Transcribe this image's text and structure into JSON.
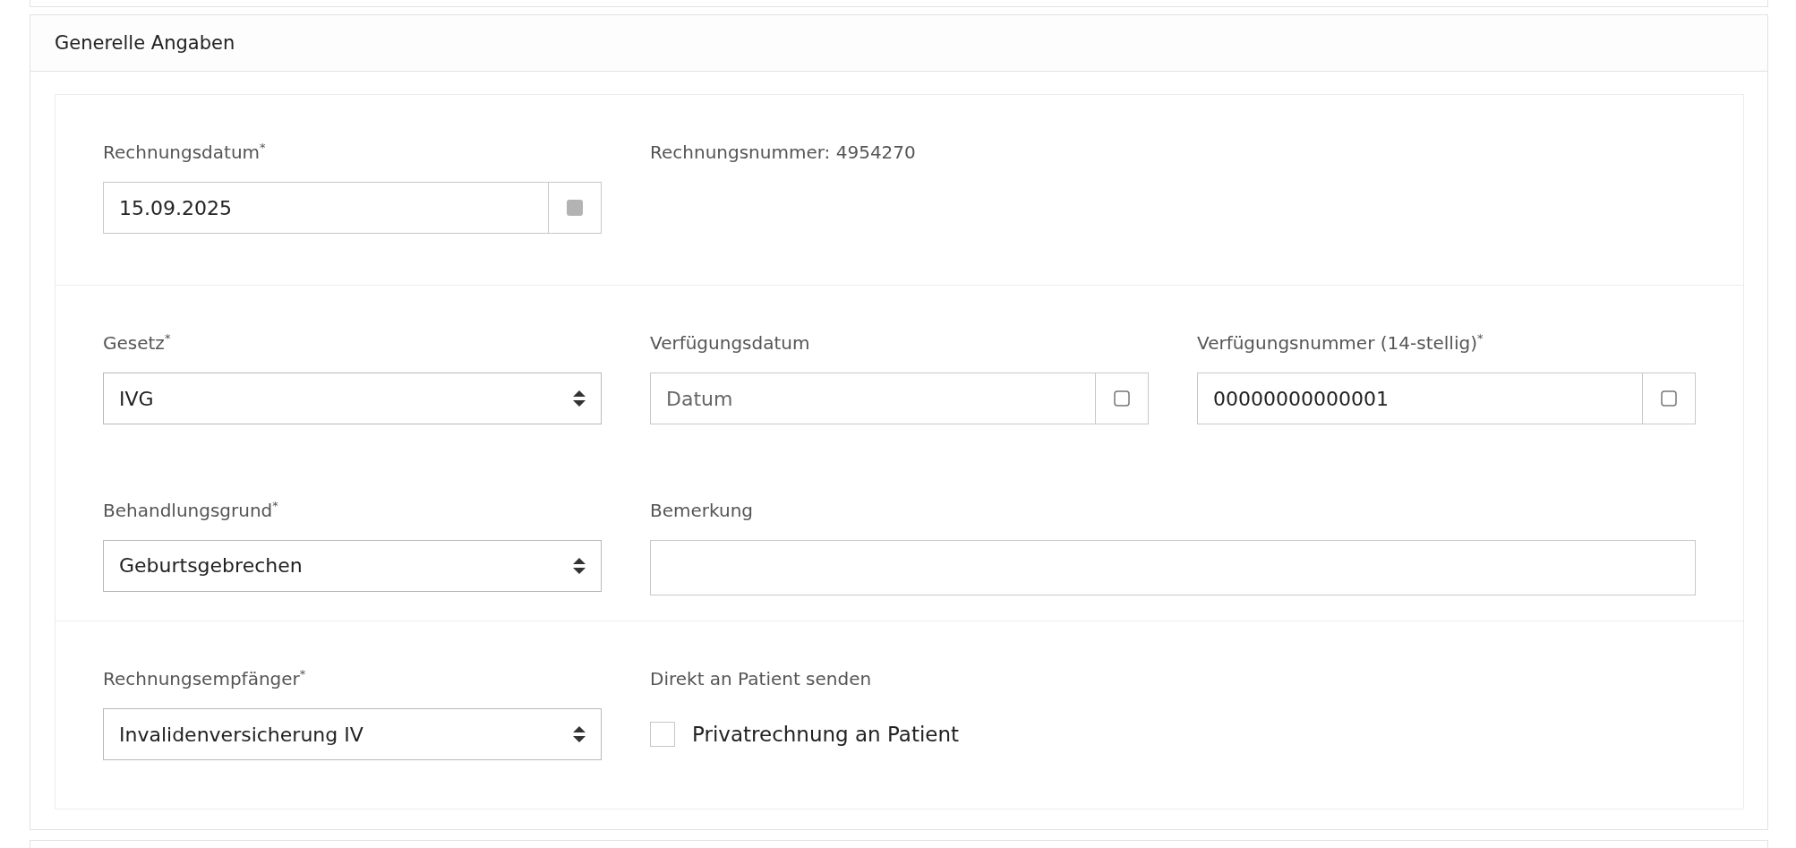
{
  "panel": {
    "title": "Generelle Angaben"
  },
  "sections": [
    {
      "fields": [
        {
          "kind": "date",
          "label": "Rechnungsdatum$^{*}$",
          "value": "15.09.2025"
        },
        {
          "kind": "info",
          "text": "Rechnungsnummer: 4954270"
        }
      ]
    },
    {
      "fields": [
        {
          "kind": "select",
          "label": "Gesetz$^{*}$",
          "value": "IVG"
        },
        {
          "kind": "picker",
          "label": "Verfügungsdatum",
          "placeholder": "Datum"
        },
        {
          "kind": "picker",
          "label": "Verfügungsnummer (14-stellig)$^{*}$",
          "value": "00000000000001"
        },
        {
          "kind": "select",
          "label": "Behandlungsgrund$^{*}$",
          "value": "Geburtsgebrechen"
        },
        {
          "kind": "text",
          "label": "Bemerkung"
        }
      ]
    },
    {
      "fields": [
        {
          "kind": "select",
          "label": "Rechnungsempfänger$^{*}$",
          "value": "Invalidenversicherung IV"
        },
        {
          "kind": "checkbox",
          "label": "Direkt an Patient senden",
          "option": "Privatrechnung an Patient",
          "checked": false
        }
      ]
    }
  ]
}
